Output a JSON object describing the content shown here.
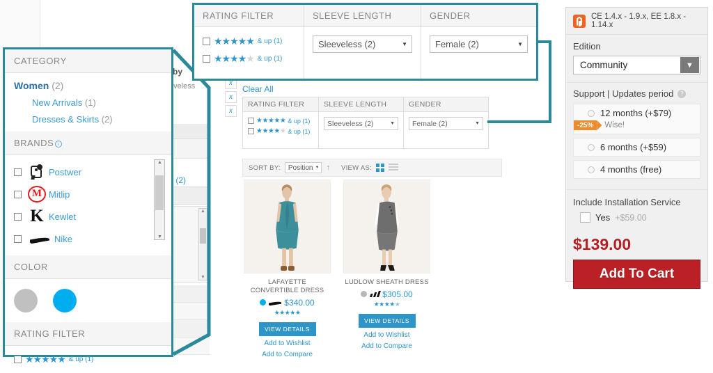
{
  "background": {
    "shop_by": "by",
    "applied_sleeveless": "eveless",
    "applied_length": "h",
    "remove_marks": [
      "x",
      "x",
      "x"
    ],
    "category_count": "s (2)"
  },
  "catalog": {
    "clear_all": "Clear All",
    "inline_filters": [
      {
        "header": "RATING FILTER",
        "type": "rating",
        "options": [
          {
            "filled": 5,
            "total": 5,
            "suffix": "& up (1)"
          },
          {
            "filled": 4,
            "total": 5,
            "suffix": "& up (1)"
          }
        ]
      },
      {
        "header": "SLEEVE LENGTH",
        "type": "select",
        "value": "Sleeveless (2)"
      },
      {
        "header": "GENDER",
        "type": "select",
        "value": "Female (2)"
      }
    ],
    "toolbar": {
      "sort_by_label": "SORT BY:",
      "sort_by_value": "Position",
      "direction_icon": "sort-ascending-arrow",
      "view_as_label": "VIEW AS:",
      "grid_icon": "grid-view-icon",
      "list_icon": "list-view-icon"
    },
    "products": [
      {
        "title": "LAFAYETTE CONVERTIBLE DRESS",
        "price": "$340.00",
        "swatch": "#00aeef",
        "brand_icon": "nike-swoosh-icon",
        "rating": 5,
        "view_details": "VIEW DETAILS",
        "wishlist": "Add to Wishlist",
        "compare": "Add to Compare"
      },
      {
        "title": "LUDLOW SHEATH DRESS",
        "price": "$305.00",
        "swatch": "#b8b8b8",
        "brand_icon": "adidas-trefoil-icon",
        "rating": 4.5,
        "view_details": "VIEW DETAILS",
        "wishlist": "Add to Wishlist",
        "compare": "Add to Compare"
      }
    ]
  },
  "callout_top": {
    "columns": [
      {
        "header": "RATING FILTER",
        "type": "rating",
        "options": [
          {
            "filled": 5,
            "total": 5,
            "suffix": "& up (1)"
          },
          {
            "filled": 4,
            "total": 5,
            "suffix": "& up (1)"
          }
        ]
      },
      {
        "header": "SLEEVE LENGTH",
        "type": "select",
        "value": "Sleeveless (2)"
      },
      {
        "header": "GENDER",
        "type": "select",
        "value": "Female (2)"
      }
    ]
  },
  "callout_left": {
    "category": {
      "header": "CATEGORY",
      "root": {
        "label": "Women",
        "count": "(2)"
      },
      "children": [
        {
          "label": "New Arrivals",
          "count": "(1)"
        },
        {
          "label": "Dresses & Skirts",
          "count": "(2)"
        }
      ]
    },
    "brands": {
      "header": "BRANDS",
      "info_icon": "info-icon",
      "items": [
        {
          "name": "Postwer",
          "logo": "postwer-panda-logo"
        },
        {
          "name": "Mitlip",
          "logo": "mitlip-m-circle-logo"
        },
        {
          "name": "Kewlet",
          "logo": "kewlet-k-logo"
        },
        {
          "name": "Nike",
          "logo": "nike-swoosh-logo"
        }
      ]
    },
    "color": {
      "header": "COLOR",
      "swatches": [
        "#c0c0c0",
        "#00aeef"
      ]
    },
    "rating": {
      "header": "RATING FILTER",
      "options": [
        {
          "filled": 5,
          "total": 5,
          "suffix": "& up (1)"
        }
      ]
    }
  },
  "right_panel": {
    "compat_text": "CE 1.4.x - 1.9.x, EE 1.8.x - 1.14.x",
    "logo_icon": "magento-logo-icon",
    "edition": {
      "label": "Edition",
      "value": "Community",
      "dropdown_icon": "chevron-down-icon"
    },
    "support": {
      "label": "Support | Updates period",
      "help_icon": "help-circle-icon",
      "options": [
        {
          "text": "12 months (+$79)",
          "badge": "-25%",
          "badge_note": "Wise!",
          "selected": false
        },
        {
          "text": "6 months (+$59)",
          "selected": false
        },
        {
          "text": "4 months (free)",
          "selected": false
        }
      ]
    },
    "install": {
      "label": "Include Installation Service",
      "checkbox_label": "Yes",
      "checkbox_price": "+$59.00",
      "checked": false
    },
    "price": "$139.00",
    "add_to_cart": "Add To Cart"
  },
  "colors": {
    "callout_border": "#2b8a99",
    "link_blue": "#2e95c9",
    "magento_orange": "#f26322",
    "cart_red": "#bb2026",
    "price_red": "#b61f24",
    "badge_orange": "#f0892a"
  }
}
